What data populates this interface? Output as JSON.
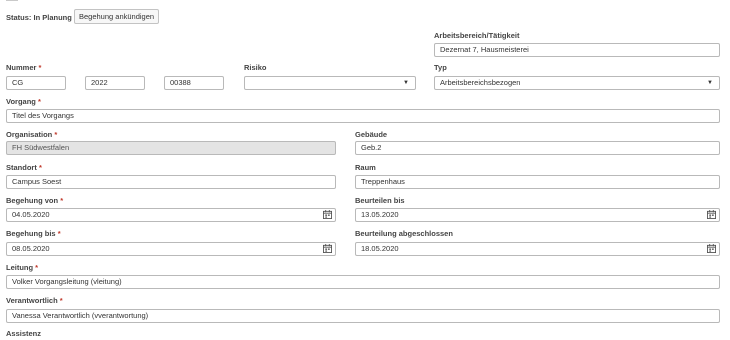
{
  "status": {
    "label": "Status: In Planung",
    "announce_button": "Begehung ankündigen"
  },
  "arbeitsbereich": {
    "label": "Arbeitsbereich/Tätigkeit",
    "value": "Dezernat 7, Hausmeisterei"
  },
  "nummer": {
    "label": "Nummer",
    "part1": "CG",
    "part2": "2022",
    "part3": "00388"
  },
  "risiko": {
    "label": "Risiko",
    "value": ""
  },
  "typ": {
    "label": "Typ",
    "value": "Arbeitsbereichsbezogen"
  },
  "vorgang": {
    "label": "Vorgang",
    "value": "Titel des Vorgangs"
  },
  "organisation": {
    "label": "Organisation",
    "value": "FH Südwestfalen"
  },
  "gebaeude": {
    "label": "Gebäude",
    "value": "Geb.2"
  },
  "standort": {
    "label": "Standort",
    "value": "Campus Soest"
  },
  "raum": {
    "label": "Raum",
    "value": "Treppenhaus"
  },
  "begehung_von": {
    "label": "Begehung von",
    "value": "04.05.2020"
  },
  "beurteilen_bis": {
    "label": "Beurteilen bis",
    "value": "13.05.2020"
  },
  "begehung_bis": {
    "label": "Begehung bis",
    "value": "08.05.2020"
  },
  "beurteilung_abgeschlossen": {
    "label": "Beurteilung abgeschlossen",
    "value": "18.05.2020"
  },
  "leitung": {
    "label": "Leitung",
    "value": "Volker Vorgangsleitung (vleitung)"
  },
  "verantwortlich": {
    "label": "Verantwortlich",
    "value": "Vanessa Verantwortlich (vverantwortung)"
  },
  "assistenz": {
    "label": "Assistenz"
  },
  "required_marker": "*",
  "icons": {
    "dropdown": "chevron-down-icon",
    "date": "calendar-icon"
  }
}
